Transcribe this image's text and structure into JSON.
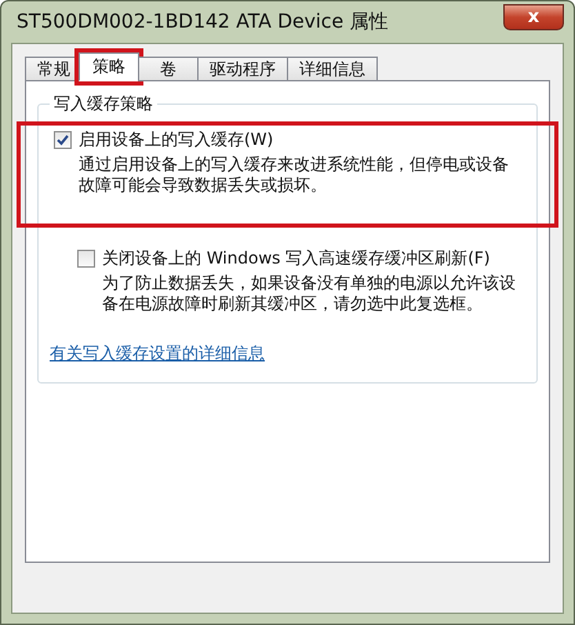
{
  "window": {
    "title": "ST500DM002-1BD142 ATA Device 属性",
    "close": "x"
  },
  "tabs": [
    {
      "label": "常规",
      "selected": false,
      "highlighted": false
    },
    {
      "label": "策略",
      "selected": true,
      "highlighted": true
    },
    {
      "label": "卷",
      "selected": false,
      "highlighted": false
    },
    {
      "label": "驱动程序",
      "selected": false,
      "highlighted": false
    },
    {
      "label": "详细信息",
      "selected": false,
      "highlighted": false
    }
  ],
  "group": {
    "title": "写入缓存策略",
    "options": [
      {
        "label": "启用设备上的写入缓存(W)",
        "checked": true,
        "highlighted": true,
        "description": "通过启用设备上的写入缓存来改进系统性能，但停电或设备故障可能会导致数据丢失或损坏。"
      },
      {
        "label": "关闭设备上的 Windows 写入高速缓存缓冲区刷新(F)",
        "checked": false,
        "highlighted": false,
        "description": "为了防止数据丢失，如果设备没有单独的电源以允许该设备在电源故障时刷新其缓冲区，请勿选中此复选框。"
      }
    ],
    "link": "有关写入缓存设置的详细信息"
  }
}
